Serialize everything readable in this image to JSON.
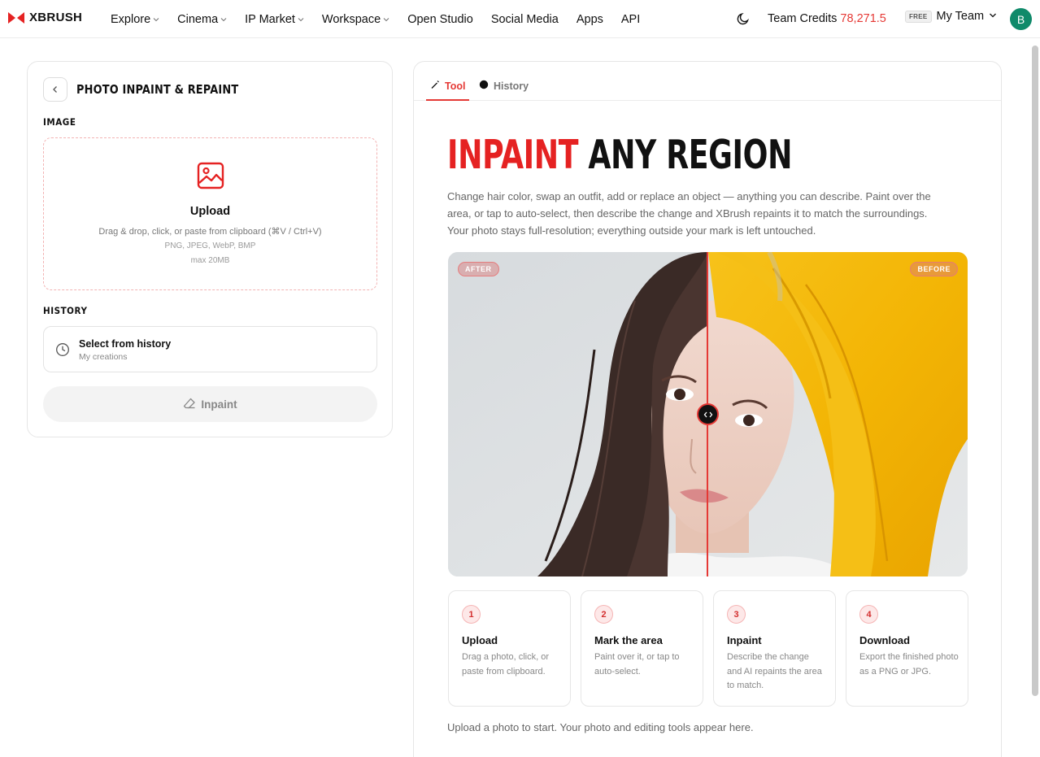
{
  "brand": {
    "name": "XBRUSH",
    "accent": "#e52222"
  },
  "nav": {
    "items": [
      {
        "label": "Explore",
        "dropdown": true
      },
      {
        "label": "Cinema",
        "dropdown": true
      },
      {
        "label": "IP Market",
        "dropdown": true
      },
      {
        "label": "Workspace",
        "dropdown": true
      },
      {
        "label": "Open Studio",
        "dropdown": false
      },
      {
        "label": "Social Media",
        "dropdown": false
      },
      {
        "label": "Apps",
        "dropdown": false
      },
      {
        "label": "API",
        "dropdown": false
      }
    ],
    "credits_label": "Team Credits",
    "credits_value": "78,271.5",
    "plan_badge": "FREE",
    "team_name": "My Team",
    "avatar_initial": "B",
    "theme_icon": "moon-icon"
  },
  "tool_panel": {
    "title": "PHOTO INPAINT & REPAINT",
    "image_label": "IMAGE",
    "upload": {
      "title": "Upload",
      "hint": "Drag & drop, click, or paste from clipboard (⌘V / Ctrl+V)",
      "formats": "PNG, JPEG, WebP, BMP",
      "max": "max 20MB"
    },
    "history_label": "HISTORY",
    "history_select": {
      "title": "Select from history",
      "subtitle": "My creations"
    },
    "action_button": "Inpaint"
  },
  "main": {
    "tabs": [
      {
        "label": "Tool",
        "active": true
      },
      {
        "label": "History",
        "active": false
      }
    ],
    "hero_accent": "INPAINT",
    "hero_rest": " ANY REGION",
    "description": "Change hair color, swap an outfit, add or replace an object — anything you can describe. Paint over the area, or tap to auto-select, then describe the change and XBrush repaints it to match the surroundings. Your photo stays full-resolution; everything outside your mark is left untouched.",
    "compare": {
      "left_badge": "AFTER",
      "right_badge": "BEFORE",
      "split_fraction": 0.5
    },
    "steps": [
      {
        "num": "1",
        "title": "Upload",
        "desc": "Drag a photo, click, or paste from clipboard."
      },
      {
        "num": "2",
        "title": "Mark the area",
        "desc": "Paint over it, or tap to auto-select."
      },
      {
        "num": "3",
        "title": "Inpaint",
        "desc": "Describe the change and AI repaints the area to match."
      },
      {
        "num": "4",
        "title": "Download",
        "desc": "Export the finished photo as a PNG or JPG."
      }
    ],
    "footer_note": "Upload a photo to start. Your photo and editing tools appear here."
  }
}
